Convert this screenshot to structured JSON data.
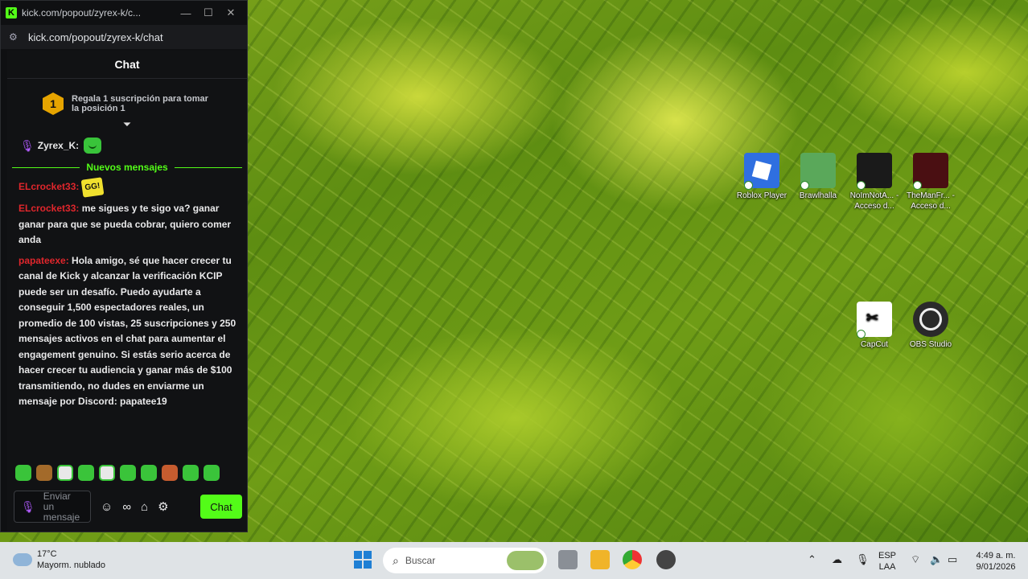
{
  "popup": {
    "title": "kick.com/popout/zyrex-k/c...",
    "url": "kick.com/popout/zyrex-k/chat",
    "header": "Chat",
    "promo_rank": "1",
    "promo_text": "Regala 1 suscripción para tomar la posición 1",
    "pinned_user": "Zyrex_K:",
    "new_messages_label": "Nuevos mensajes",
    "messages": [
      {
        "user": "ELcrocket33:",
        "text": "",
        "emote": "GG!"
      },
      {
        "user": "ELcrocket33:",
        "text": " me sigues y te sigo va? ganar ganar para que se pueda cobrar, quiero comer anda"
      },
      {
        "user": "papateexe:",
        "text": " Hola amigo, sé que hacer crecer tu canal de Kick y alcanzar la verificación KCIP puede ser un desafío. Puedo ayudarte a conseguir 1,500 espectadores reales, un promedio de 100 vistas, 25 suscripciones y 250 mensajes activos en el chat para aumentar el engagement genuino. Si estás serio acerca de hacer crecer tu audiencia y ganar más de $100 transmitiendo, no dudes en enviarme un mensaje por Discord: papatee19"
      }
    ],
    "input_placeholder": "Enviar un mensaje",
    "chat_button": "Chat",
    "accent": "#53fc18"
  },
  "desktop_icons": [
    {
      "label": "Roblox Player"
    },
    {
      "label": "Brawlhalla"
    },
    {
      "label": "NoImNotA... - Acceso d..."
    },
    {
      "label": "TheManFr... - Acceso d..."
    },
    {
      "label": "CapCut"
    },
    {
      "label": "OBS Studio"
    }
  ],
  "taskbar": {
    "weather_temp": "17°C",
    "weather_desc": "Mayorm. nublado",
    "search_placeholder": "Buscar",
    "lang_top": "ESP",
    "lang_bottom": "LAA",
    "time": "4:49 a. m.",
    "date": "9/01/2026"
  }
}
